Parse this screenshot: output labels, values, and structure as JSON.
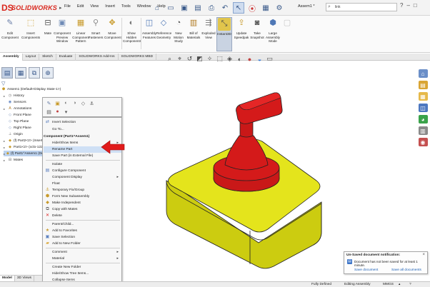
{
  "app": {
    "brand": "SOLIDWORKS",
    "brand_mark": "DS"
  },
  "menus": [
    "File",
    "Edit",
    "View",
    "Insert",
    "Tools",
    "Window",
    "Help"
  ],
  "doc_title": "Assem1 *",
  "search": {
    "value": "link"
  },
  "ribbon": {
    "buttons": [
      "Edit Component",
      "Insert Components",
      "Mate",
      "Component Preview Window",
      "Linear Component Pattern",
      "Smart Fasteners",
      "Move Component",
      "Show Hidden Components",
      "Assembly Features",
      "Reference Geometry",
      "New Motion Study",
      "Bill of Materials",
      "Exploded View",
      "Instant3D",
      "Update Speedpak",
      "Take Snapshot",
      "Large Assembly Mode",
      ""
    ]
  },
  "tabs": [
    "Assembly",
    "Layout",
    "Sketch",
    "Evaluate",
    "SOLIDWORKS Add-Ins",
    "SOLIDWORKS MBD"
  ],
  "tree": {
    "root": "Assem1  (Default<Display State-1>)",
    "items": [
      {
        "label": "History",
        "icon": "history-icon"
      },
      {
        "label": "Sensors",
        "icon": "sensor-icon"
      },
      {
        "label": "Annotations",
        "icon": "annotation-icon"
      },
      {
        "label": "Front Plane",
        "icon": "plane-icon"
      },
      {
        "label": "Top Plane",
        "icon": "plane-icon"
      },
      {
        "label": "Right Plane",
        "icon": "plane-icon"
      },
      {
        "label": "Origin",
        "icon": "origin-icon"
      },
      {
        "label": "(f) Part2<2> (Insert - 3",
        "icon": "part-icon"
      },
      {
        "label": "Part1<2> (xclo-122<<",
        "icon": "part-icon"
      },
      {
        "label": "(f) Part1^Assem1 (Default",
        "icon": "part-icon"
      },
      {
        "label": "Mates",
        "icon": "mates-icon"
      }
    ]
  },
  "context_menu": {
    "header": "Component (Part1^Assem1)",
    "items": [
      {
        "label": "Invert Selection",
        "icon": "invert-icon"
      },
      {
        "label": "Go To...",
        "icon": ""
      },
      {
        "label": "Hide/Show Items",
        "icon": "",
        "submenu": true
      },
      {
        "label": "Rename Part",
        "icon": ""
      },
      {
        "label": "Save Part (in External File)",
        "icon": ""
      },
      {
        "label": "Isolate",
        "icon": ""
      },
      {
        "label": "Configure Component",
        "icon": "configure-icon"
      },
      {
        "label": "Component Display",
        "icon": "",
        "submenu": true
      },
      {
        "label": "Float",
        "icon": ""
      },
      {
        "label": "Temporary Fix/Group",
        "icon": "fix-icon"
      },
      {
        "label": "Form New Subassembly",
        "icon": "subassembly-icon"
      },
      {
        "label": "Make Independent",
        "icon": "independent-icon"
      },
      {
        "label": "Copy with Mates",
        "icon": "copy-icon"
      },
      {
        "label": "Delete",
        "icon": "delete-icon"
      },
      {
        "label": "Parent/Child...",
        "icon": ""
      },
      {
        "label": "Add to Favorites",
        "icon": "favorite-icon"
      },
      {
        "label": "Save Selection",
        "icon": "save-icon"
      },
      {
        "label": "Add to New Folder",
        "icon": "folder-icon"
      },
      {
        "label": "Comment",
        "icon": "",
        "submenu": true
      },
      {
        "label": "Material",
        "icon": "",
        "submenu": true
      },
      {
        "label": "Create New Folder",
        "icon": ""
      },
      {
        "label": "Hide/Show Tree Items...",
        "icon": ""
      },
      {
        "label": "Collapse Items",
        "icon": ""
      }
    ],
    "more_glyph": "¥"
  },
  "left_tabs": [
    "Model",
    "3D Views"
  ],
  "notification": {
    "title": "Un-Saved document notification:",
    "message": "Document has not been saved for at least 1 minute.",
    "link_save": "Save document",
    "link_save_all": "Save all documents"
  },
  "status": {
    "state": "Fully Defined",
    "mode": "Editing Assembly",
    "units": "MMGS"
  },
  "colors": {
    "accent": "#d9261c",
    "tree_selection": "#bcd2ee",
    "menu_hover": "#cfe0f5",
    "base_part": "#e4e41c",
    "handle_part": "#d41a1a",
    "arrow": "#e11b1b"
  }
}
